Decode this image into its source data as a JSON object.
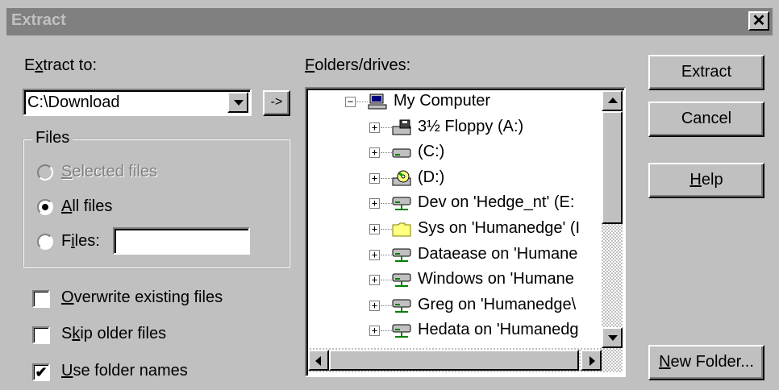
{
  "window": {
    "title": "Extract",
    "close_glyph": "✕"
  },
  "extract_to": {
    "label_pre": "E",
    "label_ul": "x",
    "label_post": "tract to:",
    "value": "C:\\Download",
    "arrow_button": "->"
  },
  "files_group": {
    "title": "Files",
    "options": [
      {
        "ul": "S",
        "rest": "elected files",
        "pre": "",
        "checked": false,
        "disabled": true
      },
      {
        "ul": "A",
        "rest": "ll files",
        "pre": "",
        "checked": true,
        "disabled": false
      },
      {
        "pre": "F",
        "ul": "i",
        "rest": "les:",
        "checked": false,
        "disabled": false
      }
    ],
    "files_value": ""
  },
  "checkboxes": [
    {
      "pre": "",
      "ul": "O",
      "rest": "verwrite existing files",
      "checked": false
    },
    {
      "pre": "S",
      "ul": "k",
      "rest": "ip older files",
      "checked": false
    },
    {
      "pre": "",
      "ul": "U",
      "rest": "se folder names",
      "checked": true
    }
  ],
  "folders": {
    "label_pre": "",
    "label_ul": "F",
    "label_post": "olders/drives:",
    "items": [
      {
        "text": "My Computer",
        "icon": "computer-icon",
        "expander": "−"
      },
      {
        "text": "3½ Floppy (A:)",
        "icon": "floppy-drive-icon",
        "expander": "+"
      },
      {
        "text": "(C:)",
        "icon": "hard-drive-icon",
        "expander": "+"
      },
      {
        "text": "(D:)",
        "icon": "cd-drive-icon",
        "expander": "+"
      },
      {
        "text": "Dev on 'Hedge_nt' (E:",
        "icon": "network-drive-icon",
        "expander": "+"
      },
      {
        "text": "Sys on 'Humanedge' (I",
        "icon": "folder-icon",
        "expander": "+"
      },
      {
        "text": "Dataease on 'Humane",
        "icon": "network-drive-icon",
        "expander": "+"
      },
      {
        "text": "Windows on 'Humane",
        "icon": "network-drive-icon",
        "expander": "+"
      },
      {
        "text": "Greg on 'Humanedge\\",
        "icon": "network-drive-icon",
        "expander": "+"
      },
      {
        "text": "Hedata on 'Humanedg",
        "icon": "network-drive-icon",
        "expander": "+"
      }
    ]
  },
  "buttons": {
    "extract": "Extract",
    "cancel": "Cancel",
    "help_ul": "H",
    "help_rest": "elp",
    "new_folder_ul": "N",
    "new_folder_rest": "ew Folder..."
  },
  "colors": {
    "face": "#c0c0c0",
    "title_inactive": "#808080",
    "folder_yellow": "#ffff80",
    "network_green": "#008000"
  }
}
